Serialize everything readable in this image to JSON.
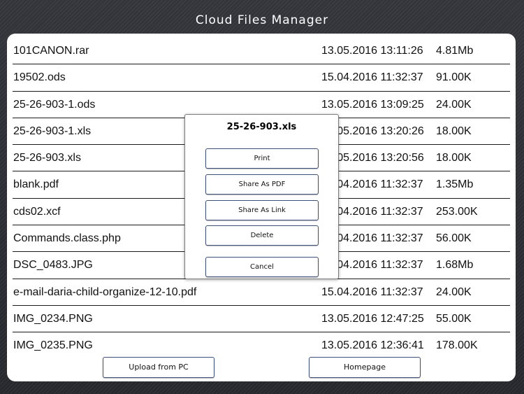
{
  "app": {
    "title": "Cloud Files Manager"
  },
  "files": [
    {
      "name": "101CANON.rar",
      "date": "13.05.2016 13:11:26",
      "size": "4.81Mb"
    },
    {
      "name": "19502.ods",
      "date": "15.04.2016 11:32:37",
      "size": "91.00K"
    },
    {
      "name": "25-26-903-1.ods",
      "date": "13.05.2016 13:09:25",
      "size": "24.00K"
    },
    {
      "name": "25-26-903-1.xls",
      "date": "13.05.2016 13:20:26",
      "size": "18.00K"
    },
    {
      "name": "25-26-903.xls",
      "date": "13.05.2016 13:20:56",
      "size": "18.00K"
    },
    {
      "name": "blank.pdf",
      "date": "15.04.2016 11:32:37",
      "size": "1.35Mb"
    },
    {
      "name": "cds02.xcf",
      "date": "15.04.2016 11:32:37",
      "size": "253.00K"
    },
    {
      "name": "Commands.class.php",
      "date": "15.04.2016 11:32:37",
      "size": "56.00K"
    },
    {
      "name": "DSC_0483.JPG",
      "date": "15.04.2016 11:32:37",
      "size": "1.68Mb"
    },
    {
      "name": "e-mail-daria-child-organize-12-10.pdf",
      "date": "15.04.2016 11:32:37",
      "size": "24.00K"
    },
    {
      "name": "IMG_0234.PNG",
      "date": "13.05.2016 12:47:25",
      "size": "55.00K"
    },
    {
      "name": "IMG_0235.PNG",
      "date": "13.05.2016 12:36:41",
      "size": "178.00K"
    }
  ],
  "footer": {
    "upload_label": "Upload from PC",
    "homepage_label": "Homepage"
  },
  "dialog": {
    "title": "25-26-903.xls",
    "print_label": "Print",
    "share_pdf_label": "Share As PDF",
    "share_link_label": "Share As Link",
    "delete_label": "Delete",
    "cancel_label": "Cancel"
  }
}
